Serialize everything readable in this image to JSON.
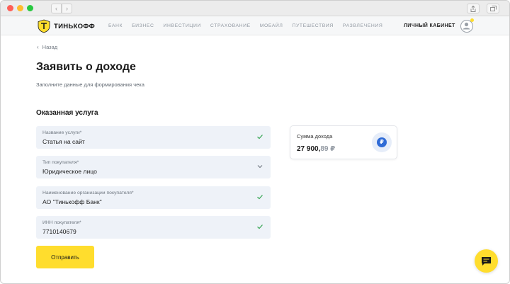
{
  "browser": {
    "back_arrow": "‹",
    "forward_arrow": "›"
  },
  "header": {
    "brand": "ТИНЬКОФФ",
    "nav": [
      "БАНК",
      "БИЗНЕС",
      "ИНВЕСТИЦИИ",
      "СТРАХОВАНИЕ",
      "МОБАЙЛ",
      "ПУТЕШЕСТВИЯ",
      "РАЗВЛЕЧЕНИЯ"
    ],
    "cabinet_label": "ЛИЧНЫЙ КАБИНЕТ"
  },
  "page": {
    "back_label": "Назад",
    "title": "Заявить о доходе",
    "subtitle": "Заполните данные для формирования чека",
    "section_title": "Оказанная услуга"
  },
  "form": {
    "fields": [
      {
        "label": "Название услуги*",
        "value": "Статья на сайт",
        "icon": "check-icon"
      },
      {
        "label": "Тип покупателя*",
        "value": "Юридическое лицо",
        "icon": "chevron-down-icon"
      },
      {
        "label": "Наименование организации покупателя*",
        "value": "АО \"Тинькофф Банк\"",
        "icon": "check-icon"
      },
      {
        "label": "ИНН покупателя*",
        "value": "7710140679",
        "icon": "check-icon"
      }
    ],
    "submit_label": "Отправить"
  },
  "income": {
    "label": "Сумма дохода",
    "amount_main": "27 900,",
    "amount_kopecks": "89 ₽",
    "badge_symbol": "₽"
  },
  "colors": {
    "accent": "#ffdd2d",
    "field_bg": "#eef2f8",
    "check": "#3aa757",
    "badge_blue": "#2f6bd6"
  }
}
